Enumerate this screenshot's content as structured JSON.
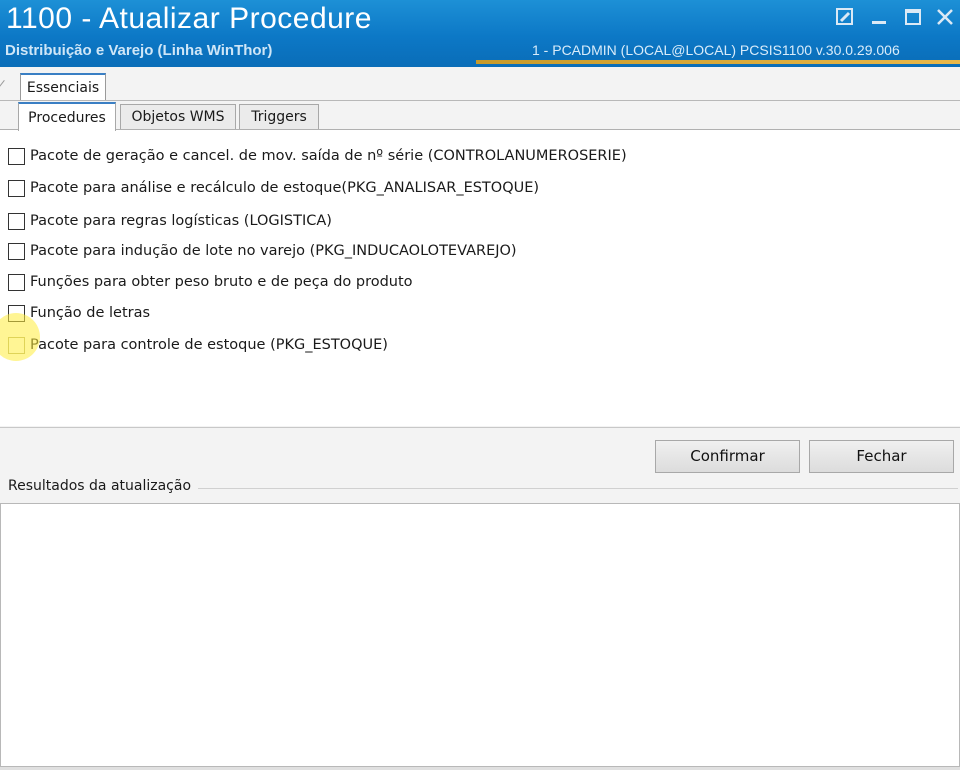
{
  "window": {
    "title": "1100 - Atualizar Procedure",
    "subtitle": "Distribuição e Varejo (Linha WinThor)",
    "session_info": "1 - PCADMIN (LOCAL@LOCAL)   PCSIS1100  v.30.0.29.006",
    "icons": [
      "edit-icon",
      "minimize-icon",
      "maximize-icon",
      "close-icon"
    ]
  },
  "tabs": {
    "outer": [
      "Essenciais"
    ],
    "inner": [
      "Procedures",
      "Objetos WMS",
      "Triggers"
    ],
    "active_inner": "Procedures"
  },
  "procedures": [
    {
      "label": "Pacote de geração e cancel. de mov. saída de nº série (CONTROLANUMEROSERIE)",
      "checked": false
    },
    {
      "label": "Pacote para análise e recálculo de estoque(PKG_ANALISAR_ESTOQUE)",
      "checked": false
    },
    {
      "label": "Pacote para regras logísticas (LOGISTICA)",
      "checked": false
    },
    {
      "label": "Pacote para indução de lote no varejo (PKG_INDUCAOLOTEVAREJO)",
      "checked": false
    },
    {
      "label": "Funções para obter peso bruto e de peça do produto",
      "checked": false
    },
    {
      "label": "Função de letras",
      "checked": false
    },
    {
      "label": "Pacote para controle de estoque (PKG_ESTOQUE)",
      "checked": false
    }
  ],
  "actions": {
    "confirm": "Confirmar",
    "close": "Fechar"
  },
  "results": {
    "label": "Resultados da atualização",
    "content": ""
  },
  "colors": {
    "titlebar": "#0c78c6",
    "accent": "#e9b84a",
    "tab_highlight": "#3a7fc4"
  }
}
